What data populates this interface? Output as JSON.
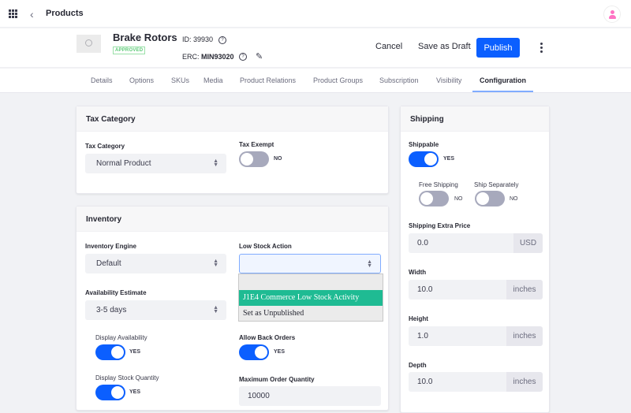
{
  "topbar": {
    "title": "Products",
    "icons": {
      "apps": "grid-icon",
      "back": "chevron-left-icon",
      "user": "user-icon"
    }
  },
  "header": {
    "product_name": "Brake Rotors",
    "status_badge": "APPROVED",
    "id_label": "ID:",
    "id_value": "39930",
    "erc_label": "ERC:",
    "erc_value": "MIN93020",
    "cancel_label": "Cancel",
    "save_draft_label": "Save as Draft",
    "publish_label": "Publish"
  },
  "tabs": [
    {
      "label": "Details"
    },
    {
      "label": "Options"
    },
    {
      "label": "SKUs"
    },
    {
      "label": "Media"
    },
    {
      "label": "Product Relations"
    },
    {
      "label": "Product Groups"
    },
    {
      "label": "Subscription"
    },
    {
      "label": "Visibility"
    },
    {
      "label": "Configuration",
      "active": true
    }
  ],
  "tax": {
    "title": "Tax Category",
    "category_label": "Tax Category",
    "category_value": "Normal Product",
    "exempt_label": "Tax Exempt",
    "exempt_state": "NO"
  },
  "inventory": {
    "title": "Inventory",
    "engine_label": "Inventory Engine",
    "engine_value": "Default",
    "low_stock_label": "Low Stock Action",
    "low_stock_value": "",
    "low_stock_options": [
      "",
      "J1E4 Commerce Low Stock Activity",
      "Set as Unpublished"
    ],
    "availability_label": "Availability Estimate",
    "availability_value": "3-5 days",
    "display_availability_label": "Display Availability",
    "display_availability_state": "YES",
    "allow_back_orders_label": "Allow Back Orders",
    "allow_back_orders_state": "YES",
    "display_stock_label": "Display Stock Quantity",
    "display_stock_state": "YES",
    "max_order_label": "Maximum Order Quantity",
    "max_order_value": "10000"
  },
  "shipping": {
    "title": "Shipping",
    "shippable_label": "Shippable",
    "shippable_state": "YES",
    "free_shipping_label": "Free Shipping",
    "free_shipping_state": "NO",
    "ship_separately_label": "Ship Separately",
    "ship_separately_state": "NO",
    "extra_price_label": "Shipping Extra Price",
    "extra_price_value": "0.0",
    "extra_price_unit": "USD",
    "width_label": "Width",
    "width_value": "10.0",
    "height_label": "Height",
    "height_value": "1.0",
    "depth_label": "Depth",
    "depth_value": "10.0",
    "dimension_unit": "inches"
  },
  "colors": {
    "primary": "#0b5fff",
    "selected_option": "#1fbb93",
    "approved": "#5aca75"
  }
}
